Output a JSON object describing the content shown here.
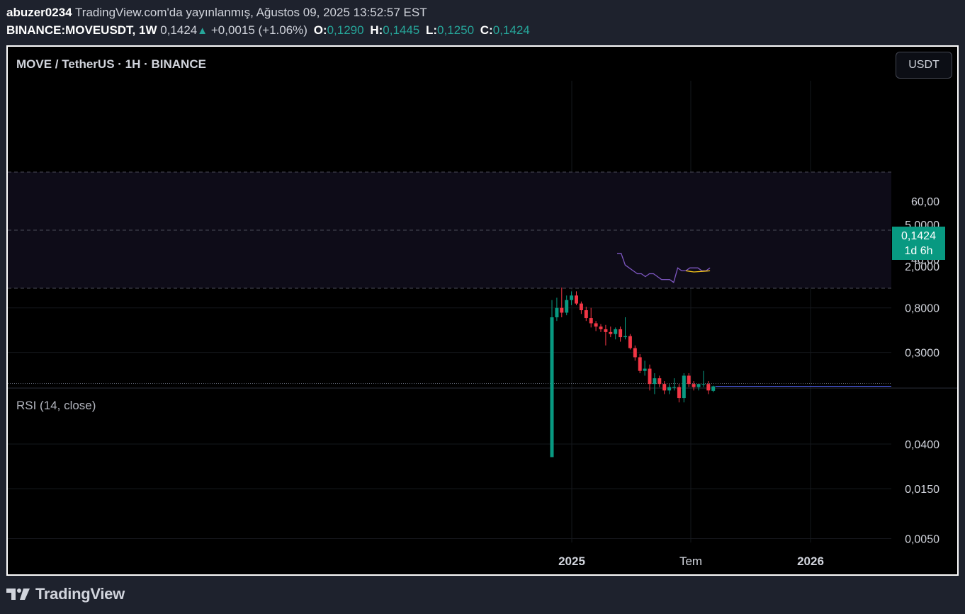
{
  "header": {
    "author": "abuzer0234",
    "published": "TradingView.com'da yayınlanmış, Ağustos 09, 2025 13:52:57 EST",
    "symbol": "BINANCE:MOVEUSDT, 1W",
    "last": "0,1424",
    "change": "+0,0015 (+1.06%)",
    "o_label": "O:",
    "o_value": "0,1290",
    "h_label": "H:",
    "h_value": "0,1445",
    "l_label": "L:",
    "l_value": "0,1250",
    "c_label": "C:",
    "c_value": "0,1424"
  },
  "pane": {
    "title": "MOVE / TetherUS · 1H · BINANCE",
    "currency_button": "USDT",
    "price_tag": {
      "price": "0,1424",
      "countdown": "1d 6h"
    }
  },
  "rsi": {
    "title": "RSI (14, close)"
  },
  "footer": {
    "brand": "TradingView"
  },
  "colors": {
    "up": "#089981",
    "down": "#f23645",
    "rsi_line": "#7e57c2",
    "rsi_ma": "#f5c518",
    "price_line": "#4a5ae0",
    "background": "#000000"
  },
  "chart_data": [
    {
      "type": "candlestick",
      "scale": "log",
      "y_tick_labels": [
        "5,0000",
        "2,0000",
        "0,8000",
        "0,3000",
        "0,0400",
        "0,0150",
        "0,0050"
      ],
      "x_tick_labels": [
        "2025",
        "Tem",
        "2026"
      ],
      "last_price": 0.1424,
      "candles": [
        {
          "o": 0.03,
          "h": 0.95,
          "l": 0.03,
          "c": 0.65
        },
        {
          "o": 0.65,
          "h": 1.0,
          "l": 0.6,
          "c": 0.8
        },
        {
          "o": 0.8,
          "h": 1.25,
          "l": 0.65,
          "c": 0.72
        },
        {
          "o": 0.72,
          "h": 1.05,
          "l": 0.68,
          "c": 0.95
        },
        {
          "o": 0.95,
          "h": 1.15,
          "l": 0.85,
          "c": 1.05
        },
        {
          "o": 1.05,
          "h": 1.15,
          "l": 0.85,
          "c": 0.88
        },
        {
          "o": 0.88,
          "h": 0.92,
          "l": 0.7,
          "c": 0.76
        },
        {
          "o": 0.76,
          "h": 0.82,
          "l": 0.6,
          "c": 0.64
        },
        {
          "o": 0.64,
          "h": 0.8,
          "l": 0.52,
          "c": 0.57
        },
        {
          "o": 0.57,
          "h": 0.6,
          "l": 0.48,
          "c": 0.53
        },
        {
          "o": 0.53,
          "h": 0.56,
          "l": 0.47,
          "c": 0.5
        },
        {
          "o": 0.5,
          "h": 0.55,
          "l": 0.35,
          "c": 0.47
        },
        {
          "o": 0.47,
          "h": 0.53,
          "l": 0.42,
          "c": 0.45
        },
        {
          "o": 0.45,
          "h": 0.52,
          "l": 0.4,
          "c": 0.5
        },
        {
          "o": 0.5,
          "h": 0.53,
          "l": 0.38,
          "c": 0.42
        },
        {
          "o": 0.42,
          "h": 0.65,
          "l": 0.4,
          "c": 0.43
        },
        {
          "o": 0.43,
          "h": 0.45,
          "l": 0.32,
          "c": 0.33
        },
        {
          "o": 0.33,
          "h": 0.35,
          "l": 0.25,
          "c": 0.27
        },
        {
          "o": 0.27,
          "h": 0.29,
          "l": 0.19,
          "c": 0.2
        },
        {
          "o": 0.2,
          "h": 0.25,
          "l": 0.18,
          "c": 0.21
        },
        {
          "o": 0.21,
          "h": 0.23,
          "l": 0.13,
          "c": 0.15
        },
        {
          "o": 0.15,
          "h": 0.19,
          "l": 0.12,
          "c": 0.17
        },
        {
          "o": 0.17,
          "h": 0.18,
          "l": 0.14,
          "c": 0.15
        },
        {
          "o": 0.15,
          "h": 0.16,
          "l": 0.12,
          "c": 0.13
        },
        {
          "o": 0.13,
          "h": 0.15,
          "l": 0.12,
          "c": 0.14
        },
        {
          "o": 0.14,
          "h": 0.17,
          "l": 0.13,
          "c": 0.14
        },
        {
          "o": 0.14,
          "h": 0.15,
          "l": 0.1,
          "c": 0.11
        },
        {
          "o": 0.11,
          "h": 0.19,
          "l": 0.1,
          "c": 0.18
        },
        {
          "o": 0.18,
          "h": 0.19,
          "l": 0.14,
          "c": 0.15
        },
        {
          "o": 0.15,
          "h": 0.16,
          "l": 0.13,
          "c": 0.14
        },
        {
          "o": 0.14,
          "h": 0.15,
          "l": 0.13,
          "c": 0.15
        },
        {
          "o": 0.15,
          "h": 0.2,
          "l": 0.14,
          "c": 0.15
        },
        {
          "o": 0.15,
          "h": 0.16,
          "l": 0.12,
          "c": 0.13
        },
        {
          "o": 0.129,
          "h": 0.1445,
          "l": 0.125,
          "c": 0.1424
        }
      ]
    },
    {
      "type": "line",
      "title": "RSI (14, close)",
      "y_tick_labels": [
        "60,00",
        "40,00"
      ],
      "bands": [
        70,
        50,
        30
      ],
      "series": [
        {
          "values": [
            42,
            42,
            38,
            37,
            36,
            35,
            35,
            34,
            35,
            35,
            34,
            33,
            33,
            33,
            32,
            37,
            36,
            36,
            37,
            37,
            37,
            36,
            36,
            37
          ]
        },
        {
          "values": [
            36,
            35.8,
            35.6,
            35.7,
            35.8,
            35.9,
            36
          ]
        }
      ]
    }
  ]
}
